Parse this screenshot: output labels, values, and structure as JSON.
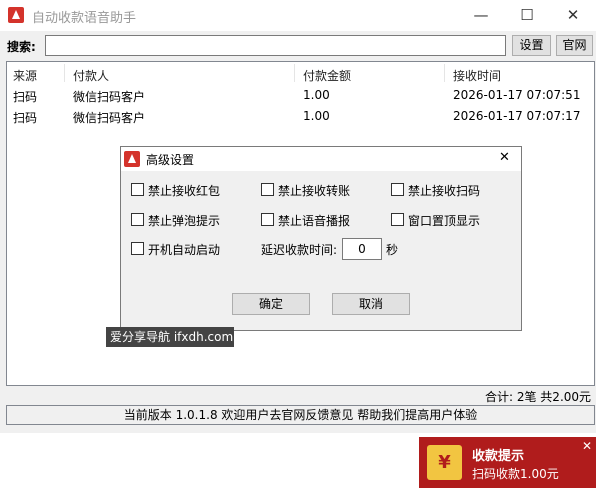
{
  "app": {
    "title": "自动收款语音助手"
  },
  "window_controls": {
    "minimize": "—",
    "maximize": "☐",
    "close": "✕"
  },
  "search": {
    "label": "搜索:",
    "value": "",
    "settings_label": "设置",
    "website_label": "官网"
  },
  "list": {
    "columns": [
      "来源",
      "付款人",
      "付款金额",
      "接收时间"
    ],
    "rows": [
      [
        "扫码",
        "微信扫码客户",
        "1.00",
        "2026-01-17 07:07:51"
      ],
      [
        "扫码",
        "微信扫码客户",
        "1.00",
        "2026-01-17 07:07:17"
      ]
    ]
  },
  "summary": "合计: 2笔 共2.00元",
  "status": "当前版本 1.0.1.8 欢迎用户去官网反馈意见 帮助我们提高用户体验",
  "dialog": {
    "title": "高级设置",
    "close": "✕",
    "options": [
      "禁止接收红包",
      "禁止接收转账",
      "禁止接收扫码",
      "禁止弹泡提示",
      "禁止语音播报",
      "窗口置顶显示",
      "开机自动启动"
    ],
    "delay_label": "延迟收款时间:",
    "delay_value": "0",
    "delay_unit": "秒",
    "ok_label": "确定",
    "cancel_label": "取消"
  },
  "watermark": "爱分享导航 ifxdh.com",
  "toast": {
    "title": "收款提示",
    "message": "扫码收款1.00元",
    "icon": "yen-icon",
    "close": "✕"
  }
}
